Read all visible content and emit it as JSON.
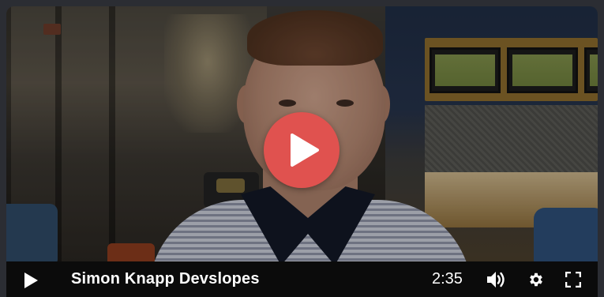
{
  "video": {
    "title": "Simon Knapp Devslopes",
    "time": "2:35",
    "accent_color": "#e0524f",
    "controls_background": "#0b0b0b"
  },
  "icons": {
    "big_play": "play-circle-icon",
    "play": "play-icon",
    "volume": "volume-icon",
    "settings": "gear-icon",
    "fullscreen": "fullscreen-icon"
  }
}
